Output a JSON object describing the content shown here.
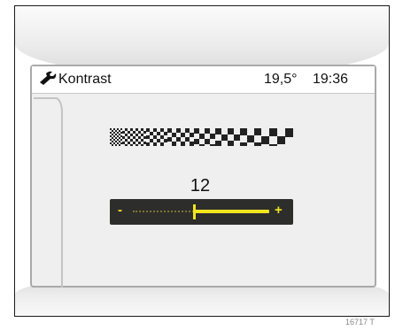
{
  "header": {
    "title": "Kontrast",
    "temperature": "19,5°",
    "time": "19:36",
    "icon": "wrench-icon"
  },
  "contrast": {
    "value": "12",
    "minus_label": "-",
    "plus_label": "+",
    "level_fraction": 0.45,
    "track_color": "#f2e51e",
    "track_bg": "#2d2d2b"
  },
  "pattern": {
    "icon": "contrast-pattern-icon"
  },
  "caption": "16717 T"
}
